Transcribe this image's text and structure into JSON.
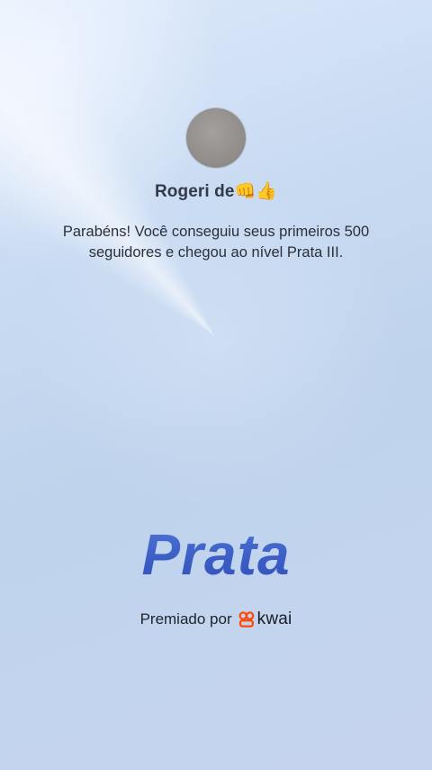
{
  "profile": {
    "username": "Rogeri de👊👍"
  },
  "congrats": {
    "message": "Parabéns! Você conseguiu seus primeiros 500 seguidores e chegou ao nível Prata III."
  },
  "level": {
    "name": "Prata"
  },
  "sponsor": {
    "label": "Premiado por",
    "brand": "kwai",
    "brand_icon": "kwai-logo-icon",
    "brand_color": "#ff4906"
  },
  "colors": {
    "level_text": "#3f63c9",
    "background_top": "#dde9fb",
    "background_bottom": "#c6d3ef"
  }
}
